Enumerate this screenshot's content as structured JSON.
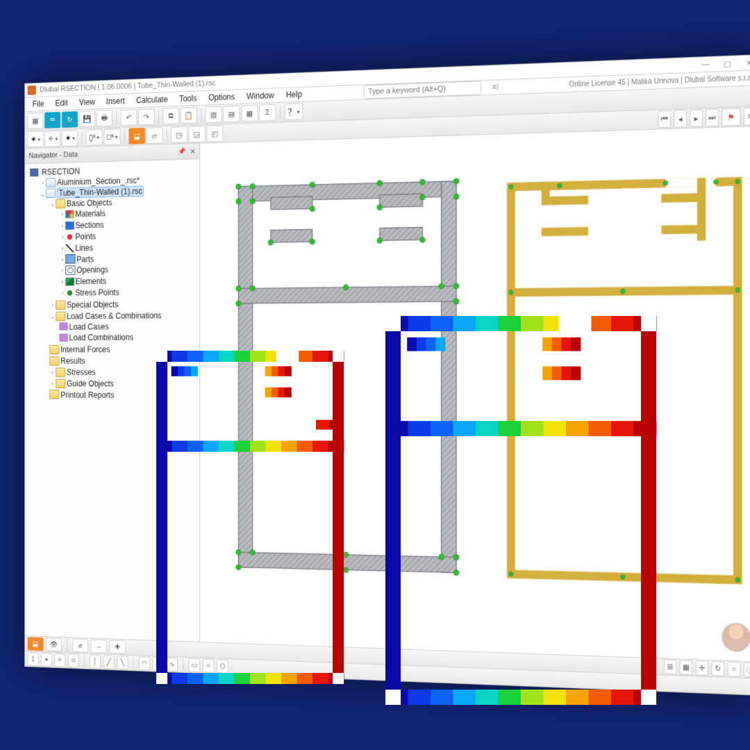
{
  "title": "Dlubal RSECTION | 1.06.0006 | Tube_Thin-Walled (1).rsc",
  "menu": [
    "File",
    "Edit",
    "View",
    "Insert",
    "Calculate",
    "Tools",
    "Options",
    "Window",
    "Help"
  ],
  "search_placeholder": "Type a keyword (Alt+Q)",
  "license": "Online License 45 | Malika Urinova | Dlubal Software s.r.o.",
  "navigator": {
    "title": "Navigator - Data",
    "root": "RSECTION",
    "files": {
      "aluminium": "Aluminium_Section_.rsc*",
      "tube": "Tube_Thin-Walled (1).rsc"
    },
    "tree": {
      "basicObjects": "Basic Objects",
      "materials": "Materials",
      "sections": "Sections",
      "points": "Points",
      "lines": "Lines",
      "parts": "Parts",
      "openings": "Openings",
      "elements": "Elements",
      "stressPoints": "Stress Points",
      "specialObjects": "Special Objects",
      "loadCasesComb": "Load Cases & Combinations",
      "loadCases": "Load Cases",
      "loadCombinations": "Load Combinations",
      "internalForces": "Internal Forces",
      "results": "Results",
      "stresses": "Stresses",
      "guideObjects": "Guide Objects",
      "printoutReports": "Printout Reports"
    }
  },
  "colors": {
    "rainbow": [
      "#0a0aa8",
      "#0f3ae8",
      "#0a63f3",
      "#0aa7f5",
      "#0ad4c6",
      "#1bd13a",
      "#a1e21a",
      "#f3e20a",
      "#f7a306",
      "#f35b05",
      "#e31608",
      "#b80404"
    ],
    "profileFill": "#d3af3e",
    "greyHatch1": "#b8b8b8",
    "greyHatch2": "#9d9d9d"
  }
}
